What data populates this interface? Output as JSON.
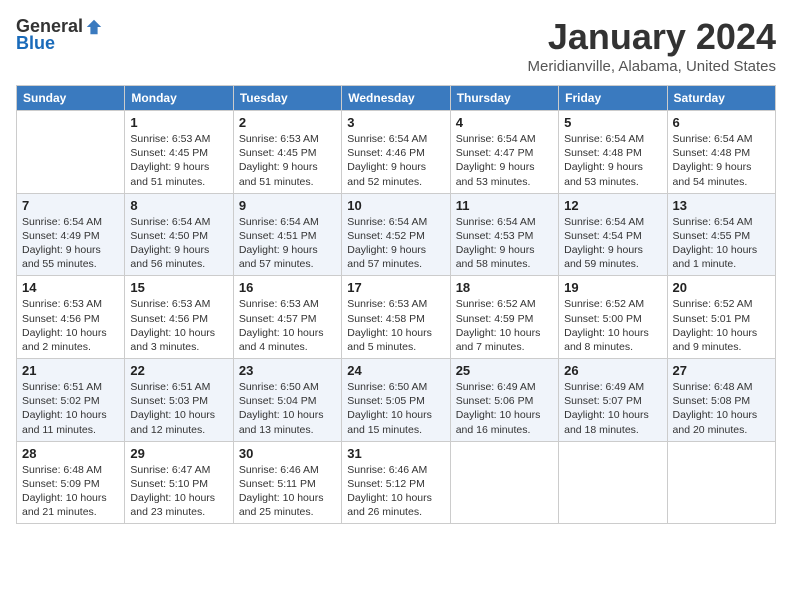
{
  "header": {
    "logo_general": "General",
    "logo_blue": "Blue",
    "month_year": "January 2024",
    "location": "Meridianville, Alabama, United States"
  },
  "days_of_week": [
    "Sunday",
    "Monday",
    "Tuesday",
    "Wednesday",
    "Thursday",
    "Friday",
    "Saturday"
  ],
  "weeks": [
    [
      {
        "day": "",
        "info": ""
      },
      {
        "day": "1",
        "info": "Sunrise: 6:53 AM\nSunset: 4:45 PM\nDaylight: 9 hours\nand 51 minutes."
      },
      {
        "day": "2",
        "info": "Sunrise: 6:53 AM\nSunset: 4:45 PM\nDaylight: 9 hours\nand 51 minutes."
      },
      {
        "day": "3",
        "info": "Sunrise: 6:54 AM\nSunset: 4:46 PM\nDaylight: 9 hours\nand 52 minutes."
      },
      {
        "day": "4",
        "info": "Sunrise: 6:54 AM\nSunset: 4:47 PM\nDaylight: 9 hours\nand 53 minutes."
      },
      {
        "day": "5",
        "info": "Sunrise: 6:54 AM\nSunset: 4:48 PM\nDaylight: 9 hours\nand 53 minutes."
      },
      {
        "day": "6",
        "info": "Sunrise: 6:54 AM\nSunset: 4:48 PM\nDaylight: 9 hours\nand 54 minutes."
      }
    ],
    [
      {
        "day": "7",
        "info": "Sunrise: 6:54 AM\nSunset: 4:49 PM\nDaylight: 9 hours\nand 55 minutes."
      },
      {
        "day": "8",
        "info": "Sunrise: 6:54 AM\nSunset: 4:50 PM\nDaylight: 9 hours\nand 56 minutes."
      },
      {
        "day": "9",
        "info": "Sunrise: 6:54 AM\nSunset: 4:51 PM\nDaylight: 9 hours\nand 57 minutes."
      },
      {
        "day": "10",
        "info": "Sunrise: 6:54 AM\nSunset: 4:52 PM\nDaylight: 9 hours\nand 57 minutes."
      },
      {
        "day": "11",
        "info": "Sunrise: 6:54 AM\nSunset: 4:53 PM\nDaylight: 9 hours\nand 58 minutes."
      },
      {
        "day": "12",
        "info": "Sunrise: 6:54 AM\nSunset: 4:54 PM\nDaylight: 9 hours\nand 59 minutes."
      },
      {
        "day": "13",
        "info": "Sunrise: 6:54 AM\nSunset: 4:55 PM\nDaylight: 10 hours\nand 1 minute."
      }
    ],
    [
      {
        "day": "14",
        "info": "Sunrise: 6:53 AM\nSunset: 4:56 PM\nDaylight: 10 hours\nand 2 minutes."
      },
      {
        "day": "15",
        "info": "Sunrise: 6:53 AM\nSunset: 4:56 PM\nDaylight: 10 hours\nand 3 minutes."
      },
      {
        "day": "16",
        "info": "Sunrise: 6:53 AM\nSunset: 4:57 PM\nDaylight: 10 hours\nand 4 minutes."
      },
      {
        "day": "17",
        "info": "Sunrise: 6:53 AM\nSunset: 4:58 PM\nDaylight: 10 hours\nand 5 minutes."
      },
      {
        "day": "18",
        "info": "Sunrise: 6:52 AM\nSunset: 4:59 PM\nDaylight: 10 hours\nand 7 minutes."
      },
      {
        "day": "19",
        "info": "Sunrise: 6:52 AM\nSunset: 5:00 PM\nDaylight: 10 hours\nand 8 minutes."
      },
      {
        "day": "20",
        "info": "Sunrise: 6:52 AM\nSunset: 5:01 PM\nDaylight: 10 hours\nand 9 minutes."
      }
    ],
    [
      {
        "day": "21",
        "info": "Sunrise: 6:51 AM\nSunset: 5:02 PM\nDaylight: 10 hours\nand 11 minutes."
      },
      {
        "day": "22",
        "info": "Sunrise: 6:51 AM\nSunset: 5:03 PM\nDaylight: 10 hours\nand 12 minutes."
      },
      {
        "day": "23",
        "info": "Sunrise: 6:50 AM\nSunset: 5:04 PM\nDaylight: 10 hours\nand 13 minutes."
      },
      {
        "day": "24",
        "info": "Sunrise: 6:50 AM\nSunset: 5:05 PM\nDaylight: 10 hours\nand 15 minutes."
      },
      {
        "day": "25",
        "info": "Sunrise: 6:49 AM\nSunset: 5:06 PM\nDaylight: 10 hours\nand 16 minutes."
      },
      {
        "day": "26",
        "info": "Sunrise: 6:49 AM\nSunset: 5:07 PM\nDaylight: 10 hours\nand 18 minutes."
      },
      {
        "day": "27",
        "info": "Sunrise: 6:48 AM\nSunset: 5:08 PM\nDaylight: 10 hours\nand 20 minutes."
      }
    ],
    [
      {
        "day": "28",
        "info": "Sunrise: 6:48 AM\nSunset: 5:09 PM\nDaylight: 10 hours\nand 21 minutes."
      },
      {
        "day": "29",
        "info": "Sunrise: 6:47 AM\nSunset: 5:10 PM\nDaylight: 10 hours\nand 23 minutes."
      },
      {
        "day": "30",
        "info": "Sunrise: 6:46 AM\nSunset: 5:11 PM\nDaylight: 10 hours\nand 25 minutes."
      },
      {
        "day": "31",
        "info": "Sunrise: 6:46 AM\nSunset: 5:12 PM\nDaylight: 10 hours\nand 26 minutes."
      },
      {
        "day": "",
        "info": ""
      },
      {
        "day": "",
        "info": ""
      },
      {
        "day": "",
        "info": ""
      }
    ]
  ]
}
